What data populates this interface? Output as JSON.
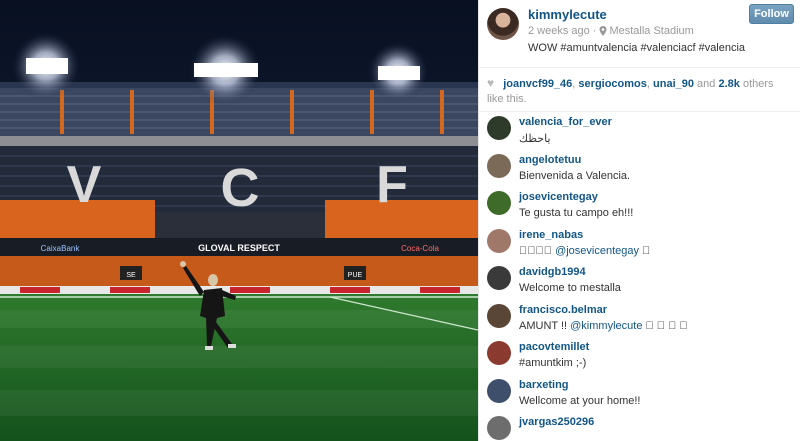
{
  "post": {
    "username": "kimmylecute",
    "time_ago": "2 weeks ago",
    "separator": "·",
    "location": "Mestalla Stadium",
    "caption": "WOW #amuntvalencia #valenciacf #valencia",
    "follow_label": "Follow"
  },
  "likes": {
    "users": [
      "joanvcf99_46",
      "sergiocomos",
      "unai_90"
    ],
    "count": "2.8k",
    "and_text": "and",
    "suffix": "others like this."
  },
  "photo": {
    "stadium_letters": [
      "V",
      "C",
      "F"
    ],
    "banner_text": "GLOVAL RESPECT",
    "sponsor_left": "CaixaBank",
    "sponsor_right": "Coca-Cola",
    "tunnel_left": "SE",
    "tunnel_right": "PUE"
  },
  "comments": [
    {
      "user": "valencia_for_ever",
      "text": "ياحظك",
      "avatar_color": "#2e3a2a"
    },
    {
      "user": "angelotetuu",
      "text": "Bienvenida a Valencia.",
      "avatar_color": "#7c6a58"
    },
    {
      "user": "josevicentegay",
      "text": "Te gusta tu campo eh!!!",
      "avatar_color": "#3f6b2a"
    },
    {
      "user": "irene_nabas",
      "text_prefix": "󾌧󾌧󾌧󾌧",
      "mention": "@josevicentegay",
      "text_suffix": " 󾌧",
      "avatar_color": "#a0786a"
    },
    {
      "user": "davidgb1994",
      "text": "Welcome to mestalla",
      "avatar_color": "#3a3a3a"
    },
    {
      "user": "francisco.belmar",
      "text_prefix": "AMUNT !! ",
      "mention": "@kimmylecute",
      "text_suffix": " 󾌧 󾌧 󾌧 󾌧",
      "avatar_color": "#5a4636"
    },
    {
      "user": "pacovtemillet",
      "text": "#amuntkim ;-)",
      "avatar_color": "#8a3a2e"
    },
    {
      "user": "barxeting",
      "text": "Wellcome at your home!!",
      "avatar_color": "#3d4f6a"
    },
    {
      "user": "jvargas250296",
      "text": "",
      "avatar_color": "#6d6d6d"
    }
  ]
}
